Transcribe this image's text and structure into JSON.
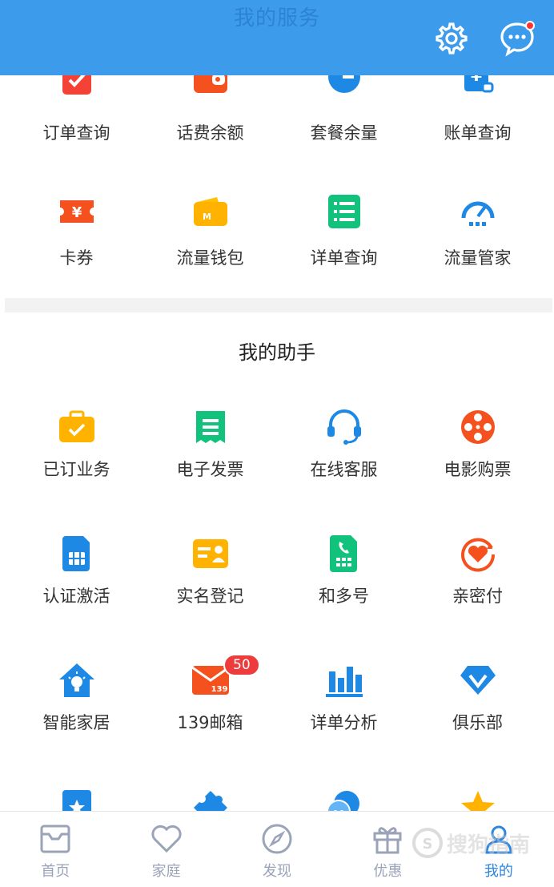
{
  "header": {
    "title": "我的服务",
    "settings_icon": "gear-icon",
    "messages_icon": "chat-bubble-icon"
  },
  "services": {
    "items": [
      {
        "label": "订单查询",
        "icon": "order-check-icon"
      },
      {
        "label": "话费余额",
        "icon": "wallet-icon"
      },
      {
        "label": "套餐余量",
        "icon": "pie-chart-icon"
      },
      {
        "label": "账单查询",
        "icon": "bill-yuan-icon"
      },
      {
        "label": "卡券",
        "icon": "coupon-ticket-icon"
      },
      {
        "label": "流量钱包",
        "icon": "data-wallet-icon"
      },
      {
        "label": "详单查询",
        "icon": "list-icon"
      },
      {
        "label": "流量管家",
        "icon": "speedometer-icon"
      }
    ]
  },
  "assistant": {
    "title": "我的助手",
    "items": [
      {
        "label": "已订业务",
        "icon": "briefcase-check-icon"
      },
      {
        "label": "电子发票",
        "icon": "receipt-icon"
      },
      {
        "label": "在线客服",
        "icon": "headset-icon"
      },
      {
        "label": "电影购票",
        "icon": "film-reel-icon"
      },
      {
        "label": "认证激活",
        "icon": "sim-card-icon"
      },
      {
        "label": "实名登记",
        "icon": "id-card-icon"
      },
      {
        "label": "和多号",
        "icon": "phone-sim-icon"
      },
      {
        "label": "亲密付",
        "icon": "heart-circle-icon"
      },
      {
        "label": "智能家居",
        "icon": "smart-home-icon"
      },
      {
        "label": "139邮箱",
        "icon": "mail-139-icon",
        "badge": "50",
        "icon_text": "139"
      },
      {
        "label": "详单分析",
        "icon": "bar-chart-icon"
      },
      {
        "label": "俱乐部",
        "icon": "diamond-icon"
      },
      {
        "label": "",
        "icon": "star-badge-icon"
      },
      {
        "label": "",
        "icon": "puzzle-icon"
      },
      {
        "label": "",
        "icon": "chat-bubbles-icon"
      },
      {
        "label": "",
        "icon": "star-icon"
      }
    ]
  },
  "bottom_nav": {
    "items": [
      {
        "label": "首页",
        "icon": "home-icon"
      },
      {
        "label": "家庭",
        "icon": "heart-icon"
      },
      {
        "label": "发现",
        "icon": "compass-icon"
      },
      {
        "label": "优惠",
        "icon": "gift-icon"
      },
      {
        "label": "我的",
        "icon": "user-icon",
        "active": true
      }
    ]
  },
  "watermark": {
    "text": "搜狗指南"
  },
  "colors": {
    "header_bg": "#3d9bec",
    "nav_active": "#2e86de",
    "nav_inactive": "#9aa3b8",
    "badge": "#ee3b3b"
  }
}
